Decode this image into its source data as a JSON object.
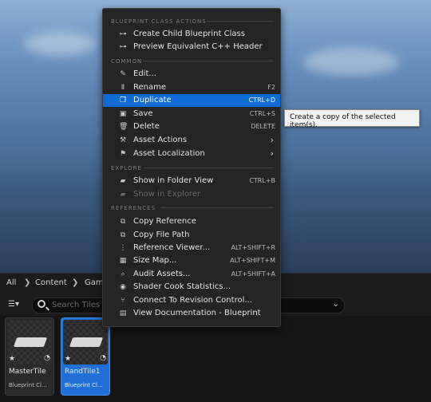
{
  "breadcrumb": {
    "items": [
      "All",
      "Content",
      "Game"
    ]
  },
  "search": {
    "placeholder": "Search Tiles"
  },
  "tiles": [
    {
      "name": "MasterTile",
      "type": "Blueprint Cl...",
      "selected": false
    },
    {
      "name": "RandTile1",
      "type": "Blueprint Cl...",
      "selected": true
    }
  ],
  "context_menu": {
    "sections": {
      "blueprint_class_actions": "BLUEPRINT CLASS ACTIONS",
      "common": "COMMON",
      "explore": "EXPLORE",
      "references": "REFERENCES"
    },
    "items": {
      "create_child": {
        "label": "Create Child Blueprint Class",
        "icon": "hierarchy-icon"
      },
      "preview_cpp": {
        "label": "Preview Equivalent C++ Header",
        "icon": "hierarchy-icon"
      },
      "edit": {
        "label": "Edit...",
        "icon": "pencil-icon"
      },
      "rename": {
        "label": "Rename",
        "shortcut": "F2",
        "icon": "rename-icon"
      },
      "duplicate": {
        "label": "Duplicate",
        "shortcut": "CTRL+D",
        "icon": "duplicate-icon"
      },
      "save": {
        "label": "Save",
        "shortcut": "CTRL+S",
        "icon": "save-icon"
      },
      "delete": {
        "label": "Delete",
        "shortcut": "DELETE",
        "icon": "trash-icon"
      },
      "asset_actions": {
        "label": "Asset Actions",
        "icon": "wrench-icon"
      },
      "asset_localization": {
        "label": "Asset Localization",
        "icon": "flag-icon"
      },
      "show_in_folder_view": {
        "label": "Show in Folder View",
        "shortcut": "CTRL+B",
        "icon": "folder-icon"
      },
      "show_in_explorer": {
        "label": "Show in Explorer",
        "icon": "folder-icon",
        "disabled": true
      },
      "copy_reference": {
        "label": "Copy Reference",
        "icon": "copy-icon"
      },
      "copy_file_path": {
        "label": "Copy File Path",
        "icon": "copy-icon"
      },
      "reference_viewer": {
        "label": "Reference Viewer...",
        "shortcut": "ALT+SHIFT+R",
        "icon": "graph-icon"
      },
      "size_map": {
        "label": "Size Map...",
        "shortcut": "ALT+SHIFT+M",
        "icon": "grid-icon"
      },
      "audit_assets": {
        "label": "Audit Assets...",
        "shortcut": "ALT+SHIFT+A",
        "icon": "audit-icon"
      },
      "shader_cook_stats": {
        "label": "Shader Cook Statistics...",
        "icon": "shader-icon"
      },
      "connect_revision_control": {
        "label": "Connect To Revision Control...",
        "icon": "revision-icon"
      },
      "view_documentation": {
        "label": "View Documentation - Blueprint",
        "icon": "book-icon"
      }
    }
  },
  "tooltip": {
    "text": "Create a copy of the selected item(s)."
  },
  "colors": {
    "highlight": "#0f6bd6",
    "menu_bg": "#242424",
    "selected_tile": "#1f6fd6"
  }
}
